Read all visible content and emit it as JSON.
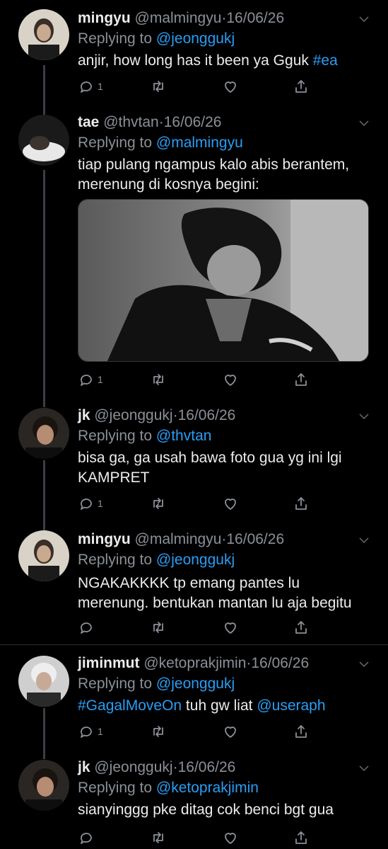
{
  "tweets": [
    {
      "name": "mingyu",
      "handle": "@malmingyu",
      "sep": "·",
      "date": "16/06/26",
      "replying_prefix": "Replying to ",
      "replying_to": "@jeonggukj",
      "text_lines": [
        "anjir, how long has it been ya Gguk "
      ],
      "hashtag": "#ea",
      "reply_count": "1"
    },
    {
      "name": "tae",
      "handle": "@thvtan",
      "sep": "·",
      "date": "16/06/26",
      "replying_prefix": "Replying to ",
      "replying_to": "@malmingyu",
      "text_lines": [
        "tiap pulang ngampus kalo abis berantem,",
        "merenung di kosnya begini:"
      ],
      "reply_count": "1"
    },
    {
      "name": "jk",
      "handle": "@jeonggukj",
      "sep": "·",
      "date": "16/06/26",
      "replying_prefix": "Replying to ",
      "replying_to": "@thvtan",
      "text_lines": [
        "bisa ga, ga usah bawa foto gua yg ini lgi",
        "KAMPRET"
      ],
      "reply_count": "1"
    },
    {
      "name": "mingyu",
      "handle": "@malmingyu",
      "sep": "·",
      "date": "16/06/26",
      "replying_prefix": "Replying to ",
      "replying_to": "@jeonggukj",
      "text_lines": [
        "NGAKAKKKK tp emang pantes lu",
        "merenung. bentukan mantan lu aja begitu"
      ],
      "reply_count": ""
    },
    {
      "name": "jiminmut",
      "handle": "@ketoprakjimin",
      "sep": "·",
      "date": "16/06/26",
      "replying_prefix": "Replying to ",
      "replying_to": "@jeonggukj",
      "hashtag": "#GagalMoveOn",
      "mid_text": " tuh gw liat ",
      "mention": "@useraph",
      "reply_count": "1"
    },
    {
      "name": "jk",
      "handle": "@jeonggukj",
      "sep": "·",
      "date": "16/06/26",
      "replying_prefix": "Replying to ",
      "replying_to": "@ketoprakjimin",
      "text_lines": [
        "sianyinggg pke ditag cok benci bgt gua"
      ],
      "reply_count": ""
    }
  ],
  "icons": [
    "reply-icon",
    "retweet-icon",
    "like-icon",
    "share-icon",
    "chevron-down-icon"
  ],
  "colors": {
    "background": "#000000",
    "link": "#2a9df4",
    "muted": "#8b9096",
    "text": "#ececec"
  }
}
